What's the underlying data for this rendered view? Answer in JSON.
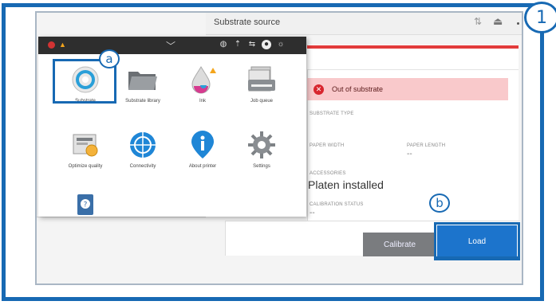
{
  "callouts": {
    "one": "1",
    "a": "a",
    "b": "b"
  },
  "header": {
    "title": "Substrate source"
  },
  "alert": {
    "text": "Out of substrate"
  },
  "details": {
    "substrate_type_label": "SUBSTRATE TYPE",
    "paper_width_label": "PAPER WIDTH",
    "paper_length_label": "PAPER LENGTH",
    "paper_length_value": "--",
    "accessories_label": "ACCESSORIES",
    "accessories_value": "Platen installed",
    "calibration_label": "CALIBRATION STATUS",
    "calibration_value": "--"
  },
  "buttons": {
    "calibrate": "Calibrate",
    "load": "Load"
  },
  "menu": {
    "tiles": [
      {
        "label": "Substrate",
        "icon": "substrate-roll-icon"
      },
      {
        "label": "Substrate library",
        "icon": "folder-icon"
      },
      {
        "label": "Ink",
        "icon": "ink-drop-icon"
      },
      {
        "label": "Job queue",
        "icon": "job-queue-icon"
      },
      {
        "label": "Optimize quality",
        "icon": "optimize-quality-icon"
      },
      {
        "label": "Connectivity",
        "icon": "connectivity-globe-icon"
      },
      {
        "label": "About printer",
        "icon": "info-icon"
      },
      {
        "label": "Settings",
        "icon": "gear-icon"
      },
      {
        "label": "",
        "icon": "help-book-icon"
      }
    ]
  },
  "colors": {
    "accent": "#1769b3",
    "alert_bg": "#f9c9cb",
    "error": "#d8262e",
    "load_button": "#1c74cc",
    "calibrate_button": "#7a7c7f"
  }
}
